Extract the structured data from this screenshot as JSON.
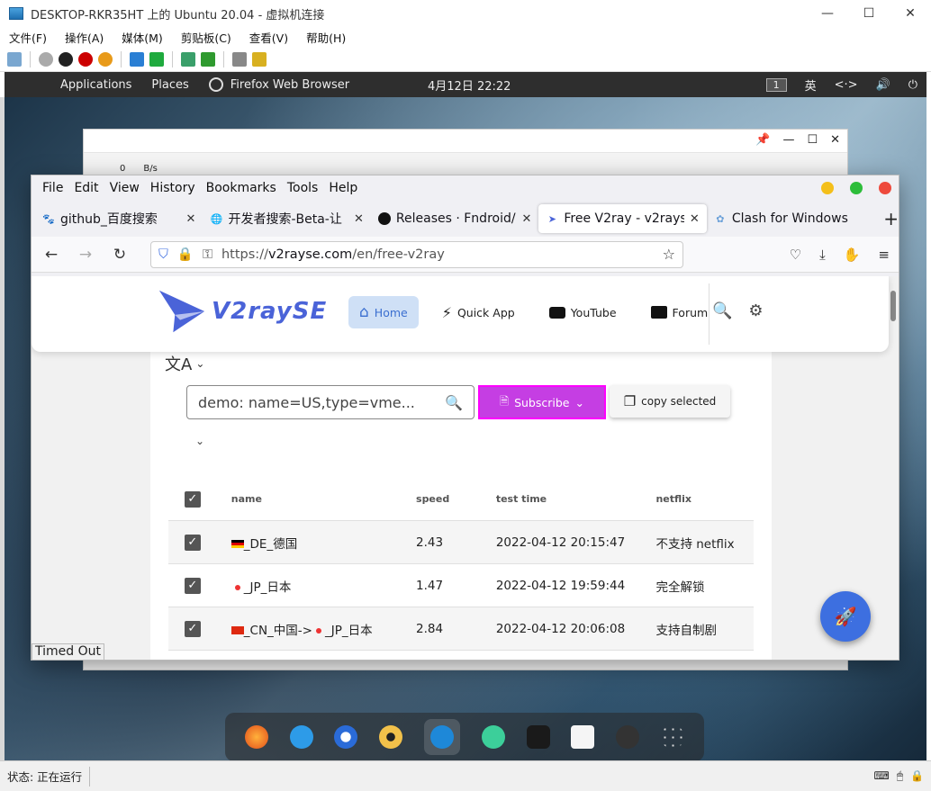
{
  "host": {
    "title": "DESKTOP-RKR35HT 上的 Ubuntu 20.04 - 虚拟机连接",
    "menu": [
      "文件(F)",
      "操作(A)",
      "媒体(M)",
      "剪贴板(C)",
      "查看(V)",
      "帮助(H)"
    ],
    "status": "状态: 正在运行"
  },
  "ubuntu": {
    "applications": "Applications",
    "places": "Places",
    "firefox": "Firefox Web Browser",
    "clock": "4月12日  22:22",
    "workspace": "1",
    "ime": "英"
  },
  "backwin": {
    "net_value": "0",
    "net_unit": "B/s"
  },
  "firefox": {
    "menu": [
      "File",
      "Edit",
      "View",
      "History",
      "Bookmarks",
      "Tools",
      "Help"
    ],
    "tabs": [
      {
        "title": "github_百度搜索"
      },
      {
        "title": "开发者搜索-Beta-让"
      },
      {
        "title": "Releases · Fndroid/"
      },
      {
        "title": "Free V2ray - v2rays"
      },
      {
        "title": "Clash for Windows"
      }
    ],
    "url_prefix": "https://",
    "url_domain": "v2rayse.com",
    "url_path": "/en/free-v2ray"
  },
  "site": {
    "logo": "V2raySE",
    "nav": [
      {
        "label": "Home"
      },
      {
        "label": "Quick App"
      },
      {
        "label": "YouTube"
      },
      {
        "label": "Forum"
      }
    ],
    "search_placeholder": "demo: name=US,type=vme...",
    "subscribe": "Subscribe",
    "copy_selected": "copy selected",
    "table": {
      "headers": [
        "name",
        "speed",
        "test time",
        "netflix"
      ],
      "rows": [
        {
          "flag": "de",
          "name": "_DE_德国",
          "speed": "2.43",
          "time": "2022-04-12 20:15:47",
          "netflix": "不支持 netflix"
        },
        {
          "flag": "jp",
          "name": "_JP_日本",
          "speed": "1.47",
          "time": "2022-04-12 19:59:44",
          "netflix": "完全解锁"
        },
        {
          "flag": "cn",
          "name_a": "_CN_中国->",
          "name_b": "_JP_日本",
          "speed": "2.84",
          "time": "2022-04-12 20:06:08",
          "netflix": "支持自制剧"
        }
      ]
    },
    "timed_out": "Timed Out"
  },
  "colors": {
    "accent": "#4a63d8",
    "subscribe": "#c53ee3",
    "fab": "#3d6fe0"
  }
}
